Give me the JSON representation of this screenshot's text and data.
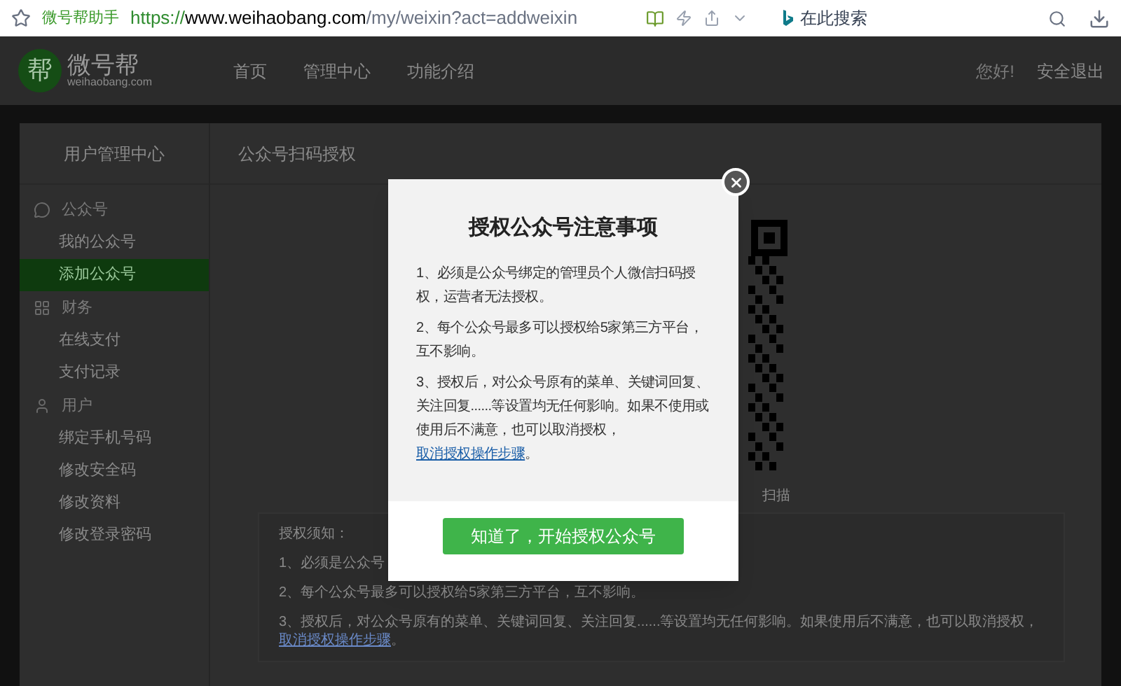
{
  "browser": {
    "tab_title": "微号帮助手",
    "url_scheme": "https://",
    "url_host": "www.weihaobang.com",
    "url_path": "/my/weixin?act=addweixin",
    "search_placeholder": "在此搜索"
  },
  "header": {
    "logo_mark": "帮",
    "logo_name": "微号帮",
    "logo_domain": "weihaobang.com",
    "nav": [
      {
        "label": "首页",
        "selected": false
      },
      {
        "label": "管理中心",
        "selected": false
      },
      {
        "label": "功能介绍",
        "selected": false
      }
    ],
    "greeting": "您好!",
    "logout": "安全退出"
  },
  "sidebar": {
    "title": "用户管理中心",
    "groups": [
      {
        "kind": "chat",
        "label": "公众号",
        "items": [
          {
            "label": "我的公众号",
            "selected": false
          },
          {
            "label": "添加公众号",
            "selected": true
          }
        ]
      },
      {
        "kind": "grid",
        "label": "财务",
        "items": [
          {
            "label": "在线支付",
            "selected": false
          },
          {
            "label": "支付记录",
            "selected": false
          }
        ]
      },
      {
        "kind": "user",
        "label": "用户",
        "items": [
          {
            "label": "绑定手机号码",
            "selected": false
          },
          {
            "label": "修改安全码",
            "selected": false
          },
          {
            "label": "修改资料",
            "selected": false
          },
          {
            "label": "修改登录密码",
            "selected": false
          }
        ]
      }
    ]
  },
  "content": {
    "title": "公众号扫码授权",
    "qr_caption": "扫描",
    "notice": {
      "title": "授权须知：",
      "line_1": "1、必须是公众号",
      "line_2": "2、每个公众号最多可以授权给5家第三方平台，互不影响。",
      "line_3": "3、授权后，对公众号原有的菜单、关键词回复、关注回复......等设置均无任何影响。如果使用后不满意，也可以取消授权，",
      "line_3_link": "取消授权操作步骤",
      "line_3_end": "。"
    }
  },
  "modal": {
    "title": "授权公众号注意事项",
    "paragraphs": [
      "1、必须是公众号绑定的管理员个人微信扫码授权，运营者无法授权。",
      "2、每个公众号最多可以授权给5家第三方平台，互不影响。",
      "3、授权后，对公众号原有的菜单、关键词回复、关注回复......等设置均无任何影响。如果不使用或使用后不满意，也可以取消授权，"
    ],
    "link": "取消授权操作步骤",
    "link_end": "。",
    "button": "知道了，开始授权公众号"
  }
}
